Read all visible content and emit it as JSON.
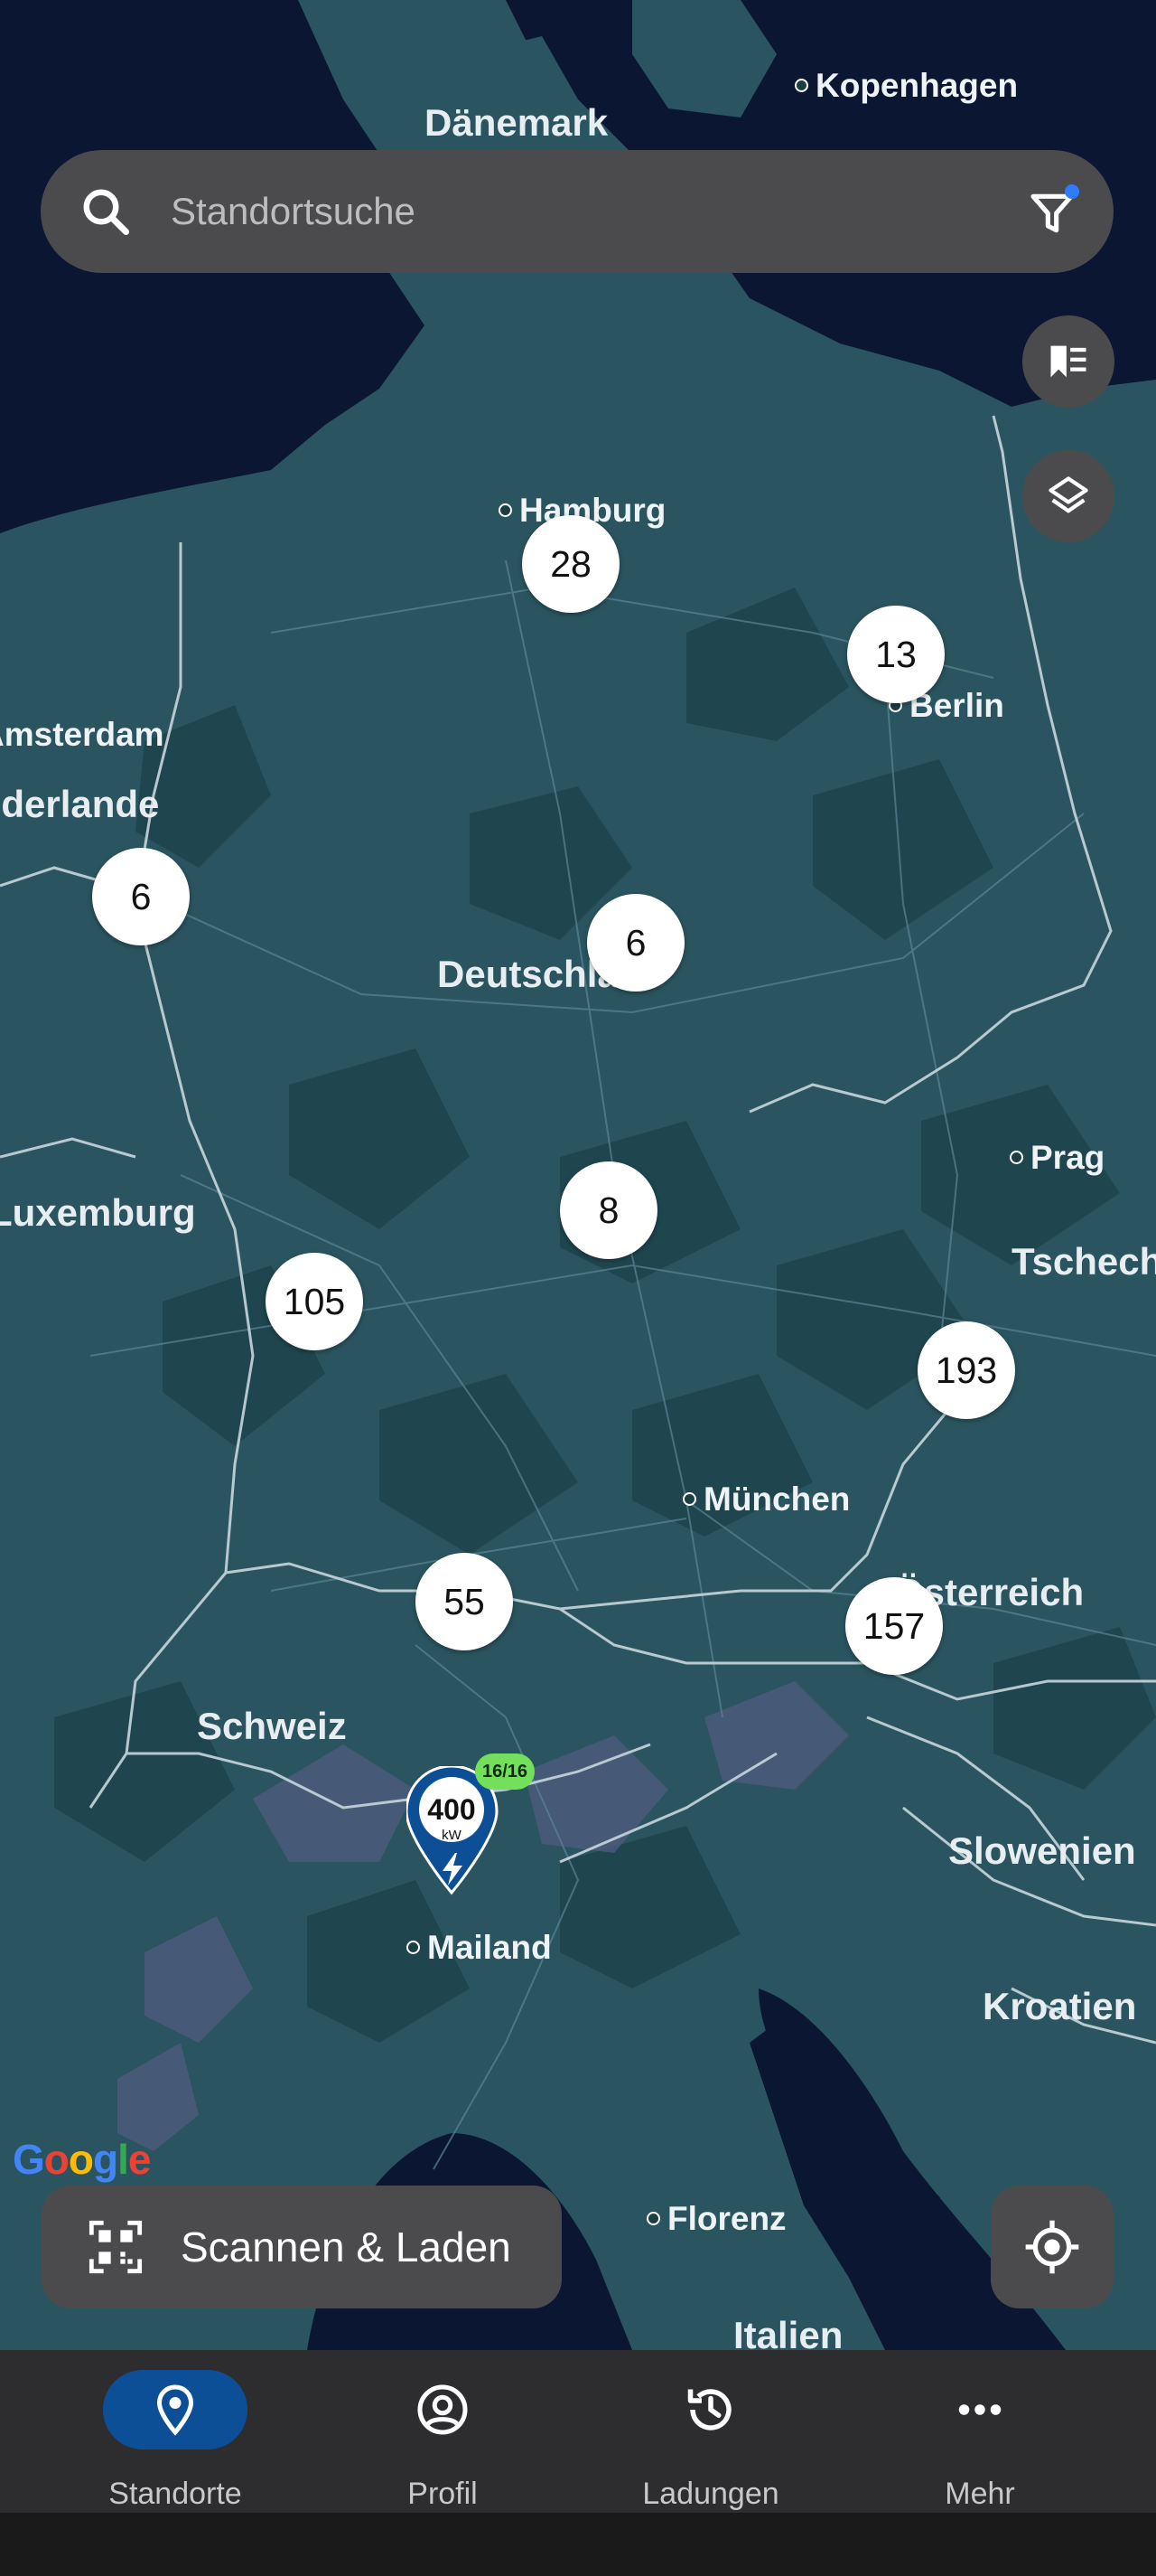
{
  "search": {
    "placeholder": "Standortsuche"
  },
  "map": {
    "countries": [
      "Dänemark",
      "Deutschland",
      "Tschechien",
      "Österreich",
      "Schweiz",
      "Slowenien",
      "Kroatien",
      "Italien",
      "Niederlande",
      "Luxemburg"
    ],
    "cities": [
      "Kopenhagen",
      "Hamburg",
      "Berlin",
      "Amsterdam",
      "Prag",
      "München",
      "Mailand",
      "Florenz"
    ],
    "clusters": [
      "28",
      "13",
      "6",
      "6",
      "8",
      "105",
      "193",
      "55",
      "157"
    ],
    "charger": {
      "power": "400",
      "unit": "kW",
      "availability": "16/16"
    },
    "attribution": "Google"
  },
  "actions": {
    "scan_label": "Scannen & Laden"
  },
  "nav": {
    "items": [
      {
        "label": "Standorte",
        "icon": "location-pin-icon",
        "active": true
      },
      {
        "label": "Profil",
        "icon": "profile-icon",
        "active": false
      },
      {
        "label": "Ladungen",
        "icon": "history-icon",
        "active": false
      },
      {
        "label": "Mehr",
        "icon": "more-icon",
        "active": false
      }
    ]
  },
  "colors": {
    "land": "#2a5560",
    "water": "#0b1633",
    "accent": "#0d4f96",
    "available": "#72e05a"
  }
}
